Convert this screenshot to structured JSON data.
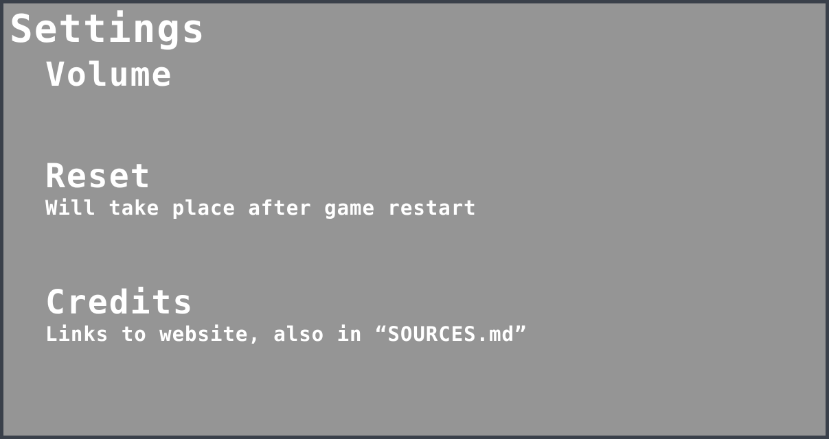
{
  "settings": {
    "title": "Settings",
    "options": [
      {
        "label": "Volume",
        "description": ""
      },
      {
        "label": "Reset",
        "description": "Will take place after game restart"
      },
      {
        "label": "Credits",
        "description": "Links to website, also in “SOURCES.md”"
      }
    ]
  },
  "colors": {
    "panel": "#959595",
    "border": "#3a404a",
    "text": "#ffffff"
  }
}
